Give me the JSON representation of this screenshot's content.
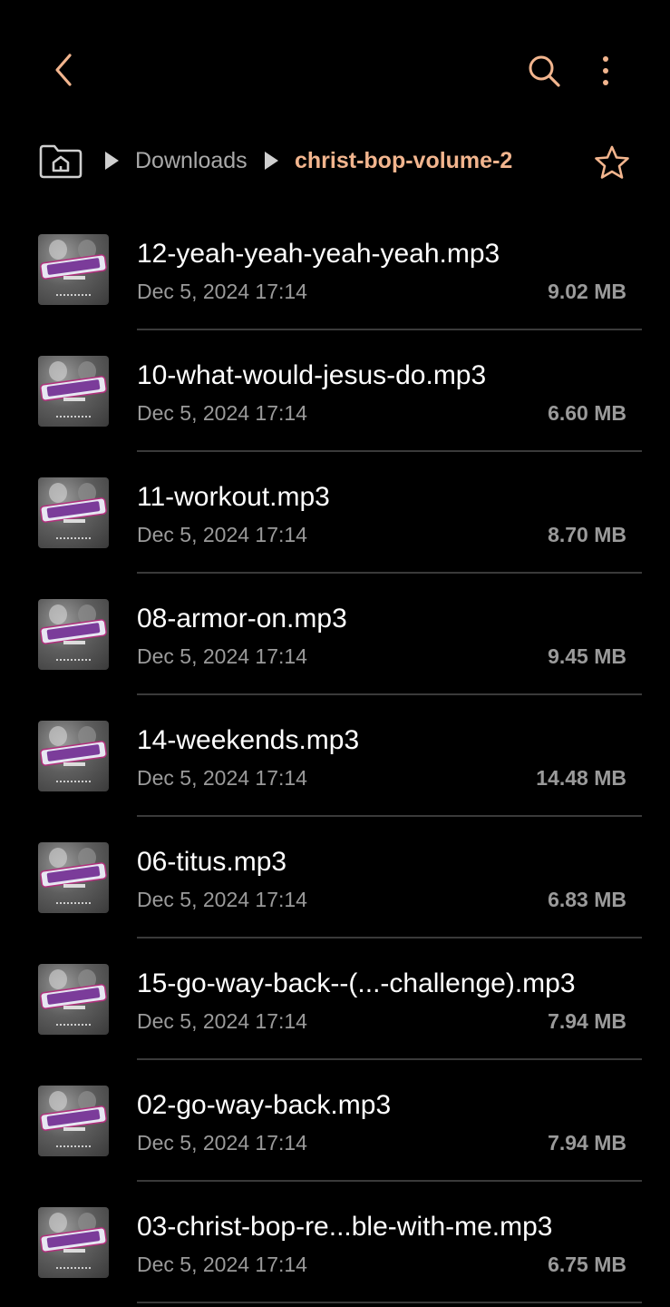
{
  "topbar": {
    "back_icon": "chevron-left-icon",
    "search_icon": "search-icon",
    "more_icon": "more-vertical-icon"
  },
  "breadcrumb": {
    "home_icon": "home-folder-icon",
    "items": [
      "Downloads",
      "christ-bop-volume-2"
    ],
    "favorite_icon": "star-outline-icon"
  },
  "colors": {
    "accent": "#f2b58e",
    "background": "#000000",
    "secondary_text": "#9a9a9a"
  },
  "files": [
    {
      "name": "12-yeah-yeah-yeah-yeah.mp3",
      "date": "Dec 5, 2024 17:14",
      "size": "9.02 MB",
      "thumb": "album-art-christ-bop"
    },
    {
      "name": "10-what-would-jesus-do.mp3",
      "date": "Dec 5, 2024 17:14",
      "size": "6.60 MB",
      "thumb": "album-art-christ-bop"
    },
    {
      "name": "11-workout.mp3",
      "date": "Dec 5, 2024 17:14",
      "size": "8.70 MB",
      "thumb": "album-art-christ-bop"
    },
    {
      "name": "08-armor-on.mp3",
      "date": "Dec 5, 2024 17:14",
      "size": "9.45 MB",
      "thumb": "album-art-christ-bop"
    },
    {
      "name": "14-weekends.mp3",
      "date": "Dec 5, 2024 17:14",
      "size": "14.48 MB",
      "thumb": "album-art-christ-bop"
    },
    {
      "name": "06-titus.mp3",
      "date": "Dec 5, 2024 17:14",
      "size": "6.83 MB",
      "thumb": "album-art-christ-bop"
    },
    {
      "name": "15-go-way-back--(...-challenge).mp3",
      "date": "Dec 5, 2024 17:14",
      "size": "7.94 MB",
      "thumb": "album-art-christ-bop"
    },
    {
      "name": "02-go-way-back.mp3",
      "date": "Dec 5, 2024 17:14",
      "size": "7.94 MB",
      "thumb": "album-art-christ-bop"
    },
    {
      "name": "03-christ-bop-re...ble-with-me.mp3",
      "date": "Dec 5, 2024 17:14",
      "size": "6.75 MB",
      "thumb": "album-art-christ-bop"
    }
  ]
}
